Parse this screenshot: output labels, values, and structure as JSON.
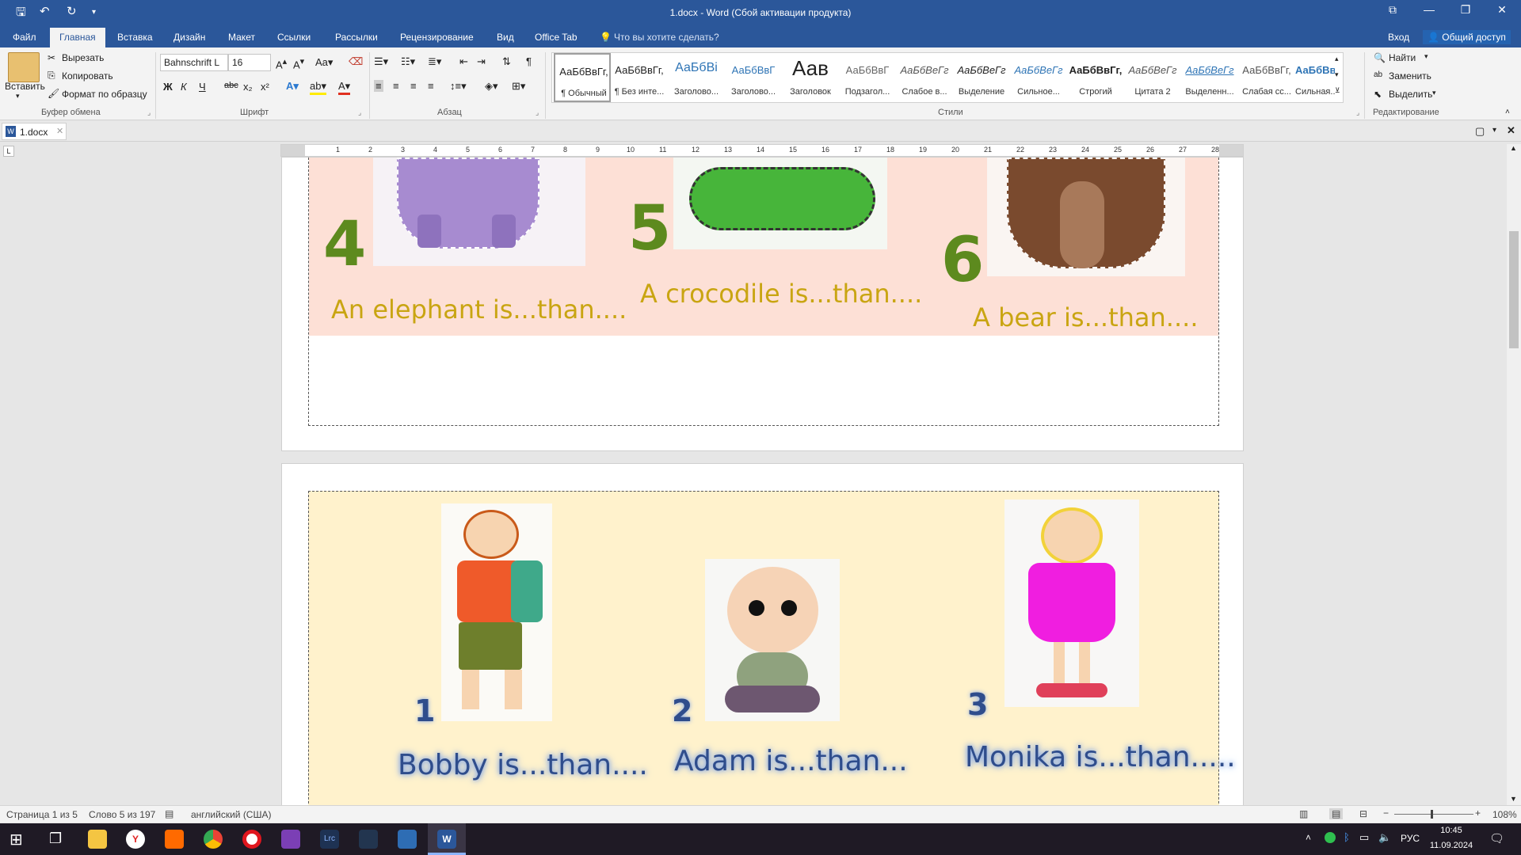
{
  "titlebar": {
    "title": "1.docx - Word (Сбой активации продукта)"
  },
  "tabs": [
    "Файл",
    "Главная",
    "Вставка",
    "Дизайн",
    "Макет",
    "Ссылки",
    "Рассылки",
    "Рецензирование",
    "Вид",
    "Office Tab"
  ],
  "tell_me": "Что вы хотите сделать?",
  "account": {
    "signin": "Вход",
    "share": "Общий доступ"
  },
  "clipboard": {
    "paste": "Вставить",
    "cut": "Вырезать",
    "copy": "Копировать",
    "format_painter": "Формат по образцу",
    "label": "Буфер обмена"
  },
  "font": {
    "name": "Bahnschrift L",
    "size": "16",
    "label": "Шрифт"
  },
  "paragraph": {
    "label": "Абзац"
  },
  "styles": {
    "label": "Стили",
    "items": [
      {
        "preview": "АаБбВвГг,",
        "name": "¶ Обычный"
      },
      {
        "preview": "АаБбВвГг,",
        "name": "¶ Без инте..."
      },
      {
        "preview": "АаБбВі",
        "name": "Заголово..."
      },
      {
        "preview": "АаБбВвГ",
        "name": "Заголово..."
      },
      {
        "preview": "Аав",
        "name": "Заголовок"
      },
      {
        "preview": "АаБбВвГ",
        "name": "Подзагол..."
      },
      {
        "preview": "АаБбВеГг",
        "name": "Слабое в..."
      },
      {
        "preview": "АаБбВеГг",
        "name": "Выделение"
      },
      {
        "preview": "АаБбВеГг",
        "name": "Сильное..."
      },
      {
        "preview": "АаБбВвГг,",
        "name": "Строгий"
      },
      {
        "preview": "АаБбВеГг",
        "name": "Цитата 2"
      },
      {
        "preview": "АаБбВеГг",
        "name": "Выделенн..."
      },
      {
        "preview": "АаБбВвГг,",
        "name": "Слабая сс..."
      },
      {
        "preview": "АаБбВвГг,",
        "name": "Сильная..."
      }
    ]
  },
  "editing": {
    "find": "Найти",
    "replace": "Заменить",
    "select": "Выделить",
    "label": "Редактирование"
  },
  "doc_tab": "1.docx",
  "ruler_numbers": [
    "1",
    "2",
    "3",
    "4",
    "5",
    "6",
    "7",
    "8",
    "9",
    "10",
    "11",
    "12",
    "13",
    "14",
    "15",
    "16",
    "17",
    "18",
    "19",
    "20",
    "21",
    "22",
    "23",
    "24",
    "25",
    "26",
    "27",
    "28"
  ],
  "page1": {
    "items": [
      {
        "number": "4",
        "sentence": "An elephant is...than...."
      },
      {
        "number": "5",
        "sentence": "A crocodile is...than...."
      },
      {
        "number": "6",
        "sentence": "A bear is...than...."
      }
    ],
    "colors": {
      "bg": "#fde0d6",
      "number": "#5d8a1e",
      "text": "#c9a512"
    }
  },
  "page2": {
    "items": [
      {
        "number": "1",
        "sentence": "Bobby is...than...."
      },
      {
        "number": "2",
        "sentence": "Adam is...than..."
      },
      {
        "number": "3",
        "sentence": "Monika is...than....."
      }
    ],
    "colors": {
      "bg": "#fff2cc",
      "text": "#2f4d8c",
      "glow": "#7fa4e8"
    }
  },
  "status": {
    "page": "Страница 1 из 5",
    "words": "Слово 5 из 197",
    "language": "английский (США)",
    "zoom": "108%"
  },
  "taskbar": {
    "lang": "РУС",
    "time": "10:45",
    "date": "11.09.2024"
  }
}
